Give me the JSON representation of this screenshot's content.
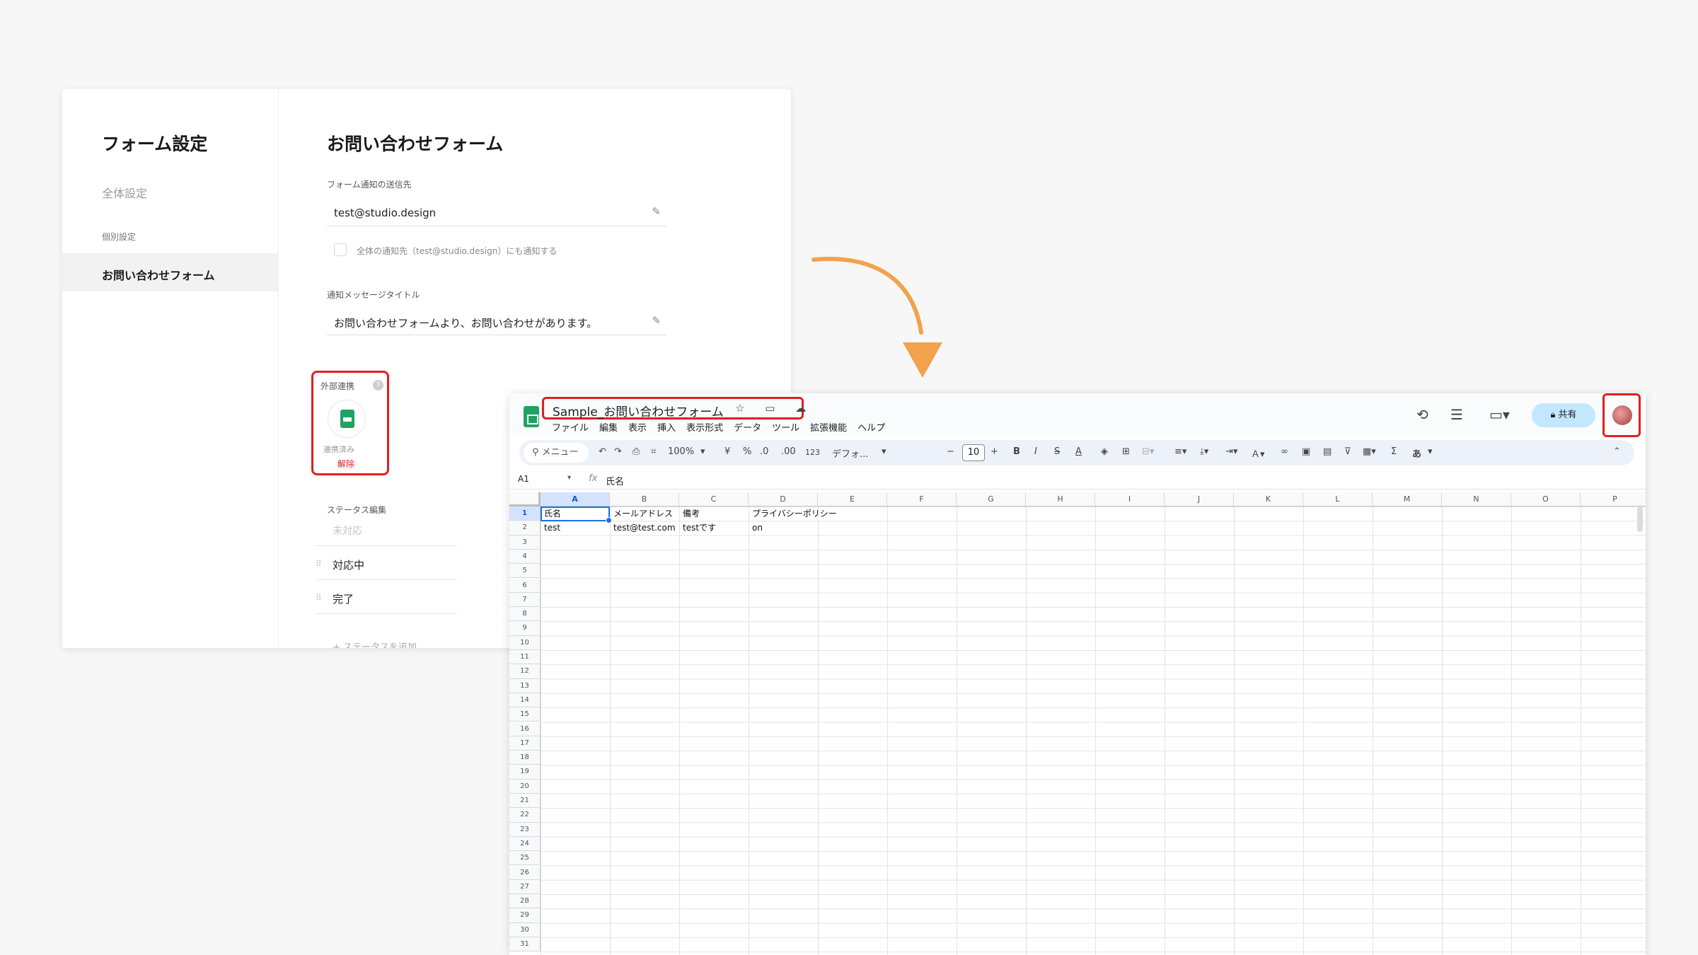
{
  "form_settings": {
    "sidebar_title": "フォーム設定",
    "nav_all": "全体設定",
    "nav_group": "個別設定",
    "nav_active": "お問い合わせフォーム",
    "main_title": "お問い合わせフォーム",
    "notify_label": "フォーム通知の送信先",
    "notify_value": "test@studio.design",
    "also_notify_label": "全体の通知先（test@studio.design）にも通知する",
    "message_title_label": "通知メッセージタイトル",
    "message_title_value": "お問い合わせフォームより、お問い合わせがあります。",
    "external_label": "外部連携",
    "external_help": "?",
    "linked_status": "連携済み",
    "unlink": "解除",
    "status_edit_label": "ステータス編集",
    "statuses": [
      "未対応",
      "対応中",
      "完了"
    ],
    "add_status": "+ ステータスを追加"
  },
  "sheets": {
    "doc_title": "Sample_お問い合わせフォーム",
    "title_icons": "☆ ▭ ☁",
    "menu": [
      "ファイル",
      "編集",
      "表示",
      "挿入",
      "表示形式",
      "データ",
      "ツール",
      "拡張機能",
      "ヘルプ"
    ],
    "share": "共有",
    "icons": {
      "history": "history-icon",
      "comment": "comment-icon",
      "meet": "meet-icon"
    },
    "toolbar": {
      "search": "メニュー",
      "zoom": "100%",
      "currency": "¥",
      "percent": "%",
      "dec_down": ".0",
      "dec_up": ".00",
      "number_format": "123",
      "font": "デフォ...",
      "font_size": "10",
      "bold": "B",
      "italic": "I",
      "strike": "S",
      "text_color": "A",
      "sigma": "Σ",
      "input": "あ"
    },
    "name_box": "A1",
    "fx": "fx",
    "formula": "氏名",
    "columns": [
      "A",
      "B",
      "C",
      "D",
      "E",
      "F",
      "G",
      "H",
      "I",
      "J",
      "K",
      "L",
      "M",
      "N",
      "O",
      "P"
    ],
    "rows": [
      "1",
      "2",
      "3",
      "4",
      "5",
      "6",
      "7",
      "8",
      "9",
      "10",
      "11",
      "12",
      "13",
      "14",
      "15",
      "16",
      "17",
      "18",
      "19",
      "20",
      "21",
      "22",
      "23",
      "24",
      "25",
      "26",
      "27",
      "28",
      "29",
      "30",
      "31"
    ],
    "cells": {
      "a1": "氏名",
      "b1": "メールアドレス",
      "c1": "備考",
      "d1": "プライバシーポリシー",
      "a2": "test",
      "b2": "test@test.com",
      "c2": "testです",
      "d2": "on"
    },
    "accent": "#e02020"
  }
}
